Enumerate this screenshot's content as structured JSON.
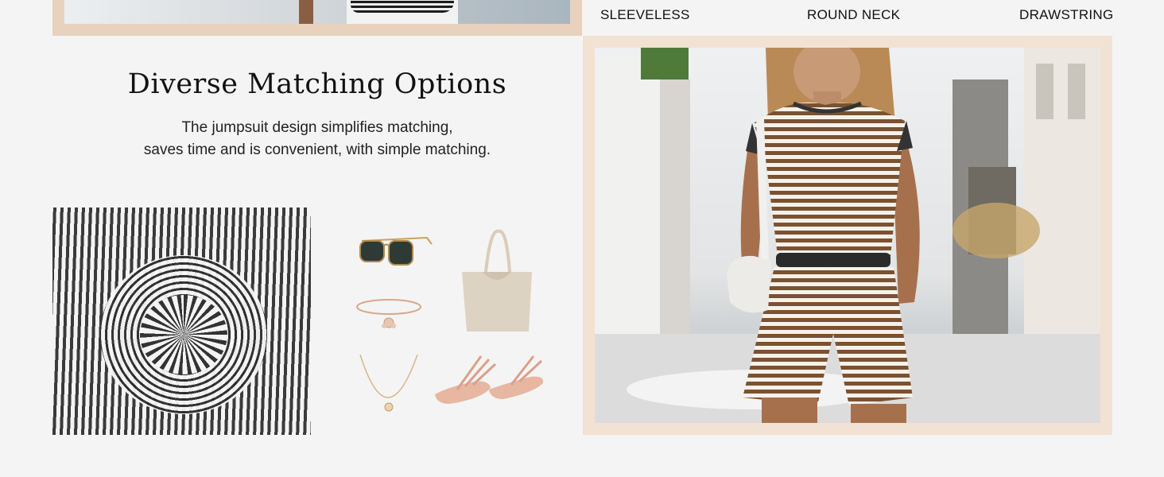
{
  "features": [
    "SLEEVELESS",
    "ROUND NECK",
    "DRAWSTRING"
  ],
  "section": {
    "title": "Diverse Matching Options",
    "description_lines": [
      "The jumpsuit design simplifies matching,",
      "saves time and is convenient, with simple matching."
    ]
  },
  "colors": {
    "page_background": "#f4f4f4",
    "frame_beige": "#e8d2bd",
    "frame_light_beige": "#f2e2d3",
    "stripe_brown": "#7a5232"
  },
  "images": {
    "top_photo": "striped-shorts-photo",
    "fabric": "striped-fabric-swatch",
    "accessories": [
      "sunglasses",
      "tote-bag",
      "bracelet",
      "necklace",
      "sandals"
    ],
    "model": "model-in-striped-romper"
  }
}
